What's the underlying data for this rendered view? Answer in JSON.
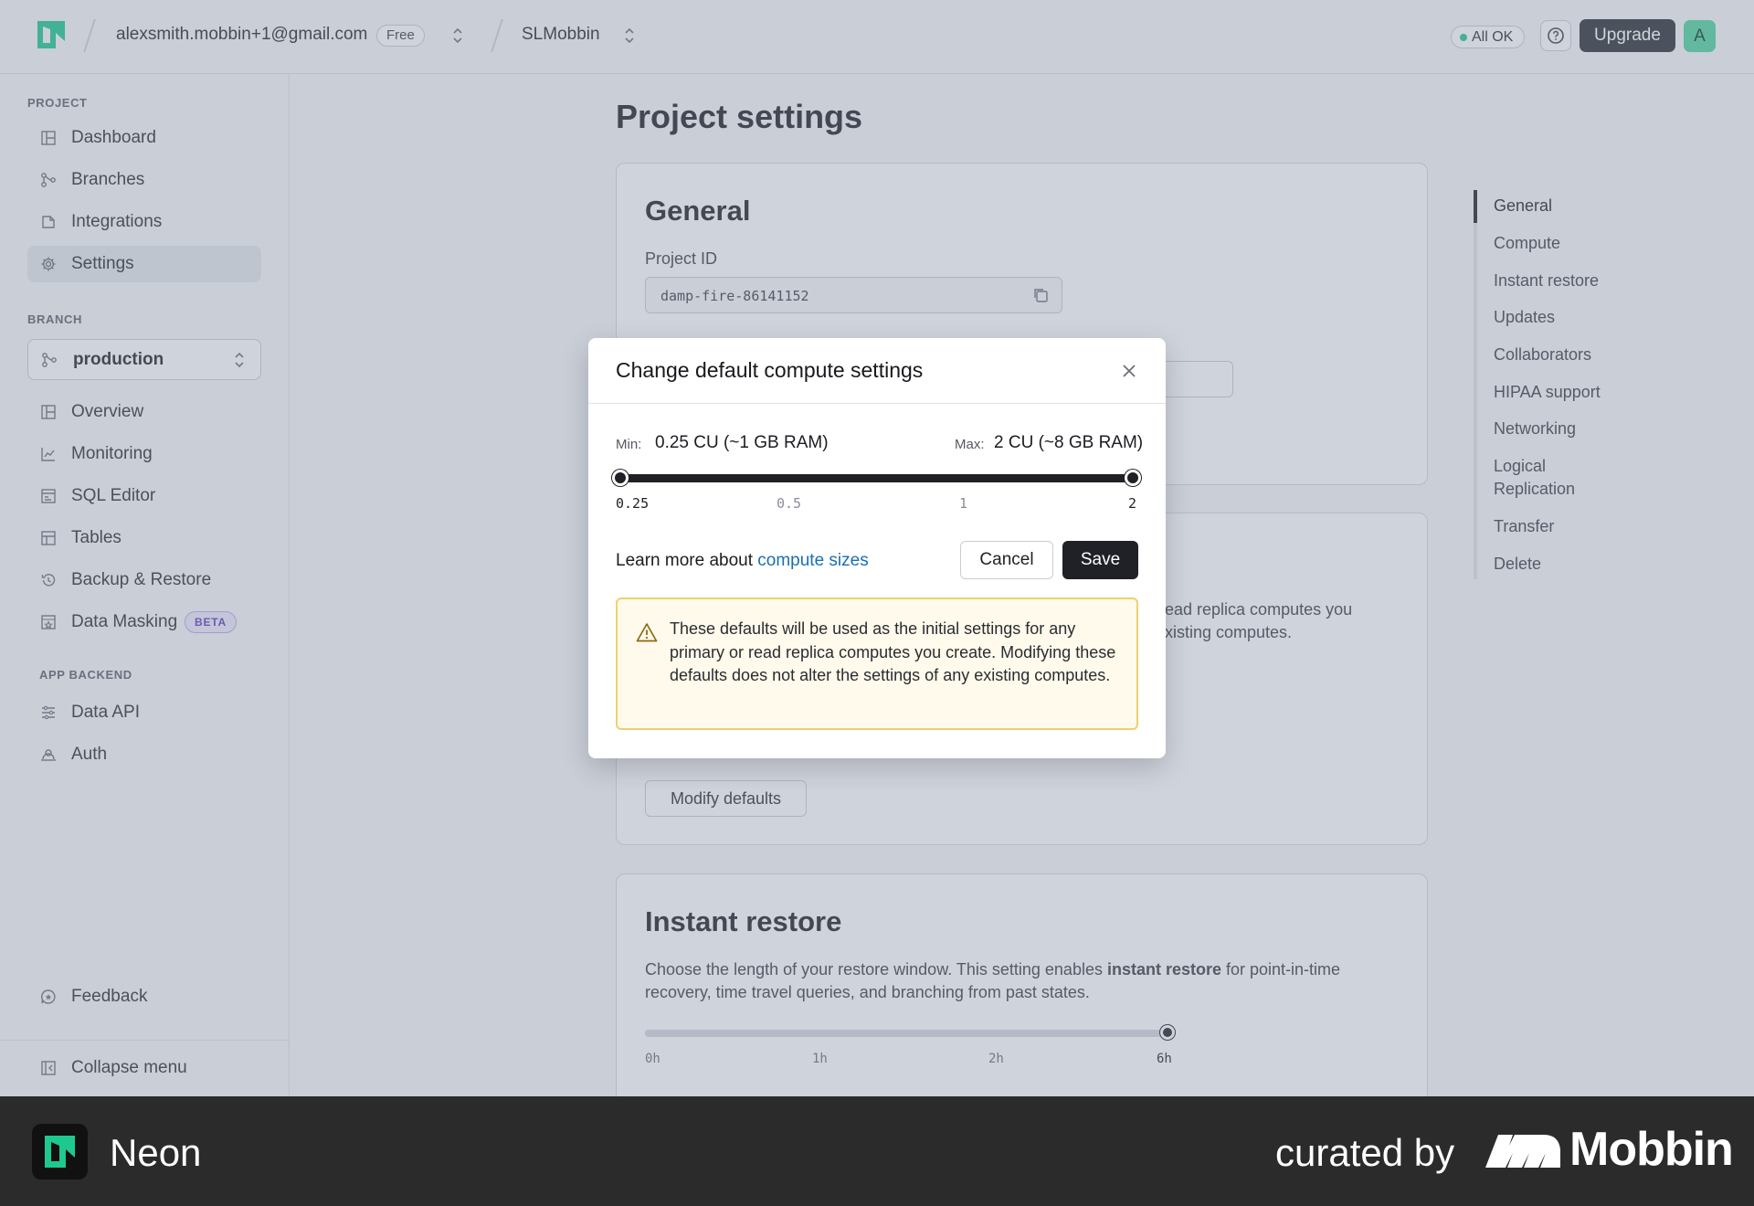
{
  "topbar": {
    "account": "alexsmith.mobbin+1@gmail.com",
    "plan_badge": "Free",
    "project": "SLMobbin",
    "status": "All OK",
    "upgrade_label": "Upgrade",
    "avatar_initial": "A"
  },
  "sidebar": {
    "project_section": "PROJECT",
    "project_items": [
      {
        "label": "Dashboard",
        "icon": "dashboard-icon"
      },
      {
        "label": "Branches",
        "icon": "branches-icon"
      },
      {
        "label": "Integrations",
        "icon": "integrations-icon"
      },
      {
        "label": "Settings",
        "icon": "gear-icon",
        "active": true
      }
    ],
    "branch_section": "BRANCH",
    "branch_selector": "production",
    "branch_items": [
      {
        "label": "Overview",
        "icon": "overview-icon"
      },
      {
        "label": "Monitoring",
        "icon": "monitoring-icon"
      },
      {
        "label": "SQL Editor",
        "icon": "sql-editor-icon"
      },
      {
        "label": "Tables",
        "icon": "tables-icon"
      },
      {
        "label": "Backup & Restore",
        "icon": "backup-icon"
      },
      {
        "label": "Data Masking",
        "icon": "data-masking-icon",
        "badge": "BETA"
      }
    ],
    "app_section": "APP BACKEND",
    "app_items": [
      {
        "label": "Data API",
        "icon": "data-api-icon"
      },
      {
        "label": "Auth",
        "icon": "auth-icon"
      }
    ],
    "feedback": "Feedback",
    "collapse": "Collapse menu"
  },
  "main": {
    "title": "Project settings",
    "general": {
      "heading": "General",
      "project_id_label": "Project ID",
      "project_id_value": "damp-fire-86141152"
    },
    "compute": {
      "text_partial_1": "ead replica computes you",
      "text_partial_2": "xisting computes.",
      "modify_button": "Modify defaults"
    },
    "instant_restore": {
      "heading": "Instant restore",
      "desc_before": "Choose the length of your restore window. This setting enables ",
      "desc_bold": "instant restore",
      "desc_after": " for point-in-time recovery, time travel queries, and branching from past states.",
      "ticks": [
        "0h",
        "1h",
        "2h",
        "6h"
      ],
      "value_fraction": 1.0
    }
  },
  "right_nav": {
    "items": [
      "General",
      "Compute",
      "Instant restore",
      "Updates",
      "Collaborators",
      "HIPAA support",
      "Networking",
      "Logical Replication",
      "Transfer",
      "Delete"
    ],
    "active": "General"
  },
  "modal": {
    "title": "Change default compute settings",
    "min_label": "Min:",
    "min_value": "0.25 CU (~1 GB RAM)",
    "max_label": "Max:",
    "max_value": "2 CU (~8 GB RAM)",
    "slider_ticks": [
      "0.25",
      "0.5",
      "1",
      "2"
    ],
    "slider_min_fraction": 0.0,
    "slider_max_fraction": 1.0,
    "learn_more_prefix": "Learn more about ",
    "learn_more_link": "compute sizes",
    "cancel_label": "Cancel",
    "save_label": "Save",
    "warning": "These defaults will be used as the initial settings for any primary or read replica computes you create. Modifying these defaults does not alter the settings of any existing computes."
  },
  "banner": {
    "app_name": "Neon",
    "curated_by": "curated by",
    "brand": "Mobbin"
  },
  "colors": {
    "accent_green": "#1ec98f",
    "link_blue": "#1a6fb5",
    "warning_border": "#f1cf6d",
    "warning_bg": "#fffaeb",
    "dark_button": "#1f2126"
  }
}
